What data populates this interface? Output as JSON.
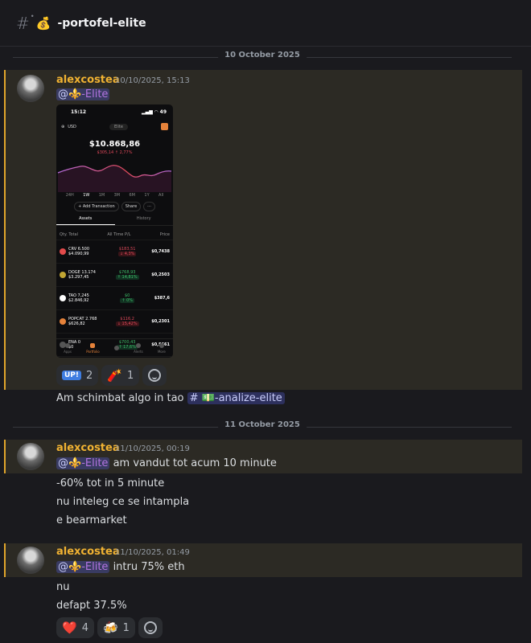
{
  "channel": {
    "emoji": "💰",
    "name": "-portofel-elite"
  },
  "dividers": [
    "10 October 2025",
    "11 October 2025"
  ],
  "messages": [
    {
      "user": "alexcostea",
      "time": "10/10/2025, 15:13",
      "role_at": "@",
      "role_emoji": "⚜️",
      "role_name": "-Elite",
      "followup": "Am schimbat algo in tao",
      "channel_mention": {
        "hash": "#",
        "emoji": "💵",
        "name": "-analize-elite"
      },
      "reactions": [
        {
          "emoji": "UP!",
          "count": "2"
        },
        {
          "emoji": "🧨",
          "count": "1"
        }
      ]
    },
    {
      "user": "alexcostea",
      "time": "11/10/2025, 00:19",
      "role_at": "@",
      "role_emoji": "⚜️",
      "role_name": "-Elite",
      "text": "am vandut tot acum 10 minute",
      "lines": [
        "-60% tot in 5 minute",
        "nu inteleg ce se intampla",
        "e bearmarket"
      ]
    },
    {
      "user": "alexcostea",
      "time": "11/10/2025, 01:49",
      "role_at": "@",
      "role_emoji": "⚜️",
      "role_name": "-Elite",
      "text": "intru 75% eth",
      "lines": [
        "nu",
        "defapt 37.5%"
      ],
      "reactions": [
        {
          "emoji": "❤️",
          "count": "4"
        },
        {
          "emoji": "🍻",
          "count": "1"
        }
      ]
    }
  ],
  "phone": {
    "time": "15:12",
    "battery": "49",
    "currency": "USD",
    "pill": "Elite",
    "balance": "$10.868,86",
    "change": "$305,14",
    "change_pct": "↑ 2,77%",
    "periods": [
      "24H",
      "1W",
      "1M",
      "3M",
      "6M",
      "1Y",
      "All"
    ],
    "buttons": [
      "+ Add Transaction",
      "Share",
      "···"
    ],
    "tabs": [
      "Assets",
      "History"
    ],
    "cols": [
      "Qty. Total",
      "All Time P/L",
      "Price"
    ],
    "assets": [
      {
        "name": "CRV",
        "qty": "6.500",
        "value": "$4.090,99",
        "pnl": "$183,51",
        "pct": "↓ 4,3%",
        "dir": "neg",
        "price": "$0,7438",
        "color": "#e34b4b"
      },
      {
        "name": "DOGE",
        "qty": "13.174",
        "value": "$3.297,45",
        "pnl": "$768,93",
        "pct": "↑ 14,81%",
        "dir": "pos",
        "price": "$0,2503",
        "color": "#c2a633"
      },
      {
        "name": "TAO",
        "qty": "7,245",
        "value": "$2.846,92",
        "pnl": "$0",
        "pct": "↑ 0%",
        "dir": "pos",
        "price": "$387,6",
        "color": "#ffffff"
      },
      {
        "name": "POPCAT",
        "qty": "2.768",
        "value": "$626,82",
        "pnl": "$116,2",
        "pct": "↓ 15,42%",
        "dir": "neg",
        "price": "$0,2301",
        "color": "#e5823a"
      },
      {
        "name": "ENA",
        "qty": "0",
        "value": "$0",
        "pnl": "$700,43",
        "pct": "↑ 17,6%",
        "dir": "pos",
        "price": "$0,5661",
        "color": "#555555"
      },
      {
        "name": "USDC",
        "qty": "0",
        "value": "$0",
        "pnl": "$0,09982",
        "pct": "↑ 0%",
        "dir": "pos",
        "price": "$0,9998",
        "color": "#2775ca"
      }
    ],
    "nav": [
      "Apps",
      "Portfolio",
      "+",
      "Alerts",
      "More"
    ]
  }
}
